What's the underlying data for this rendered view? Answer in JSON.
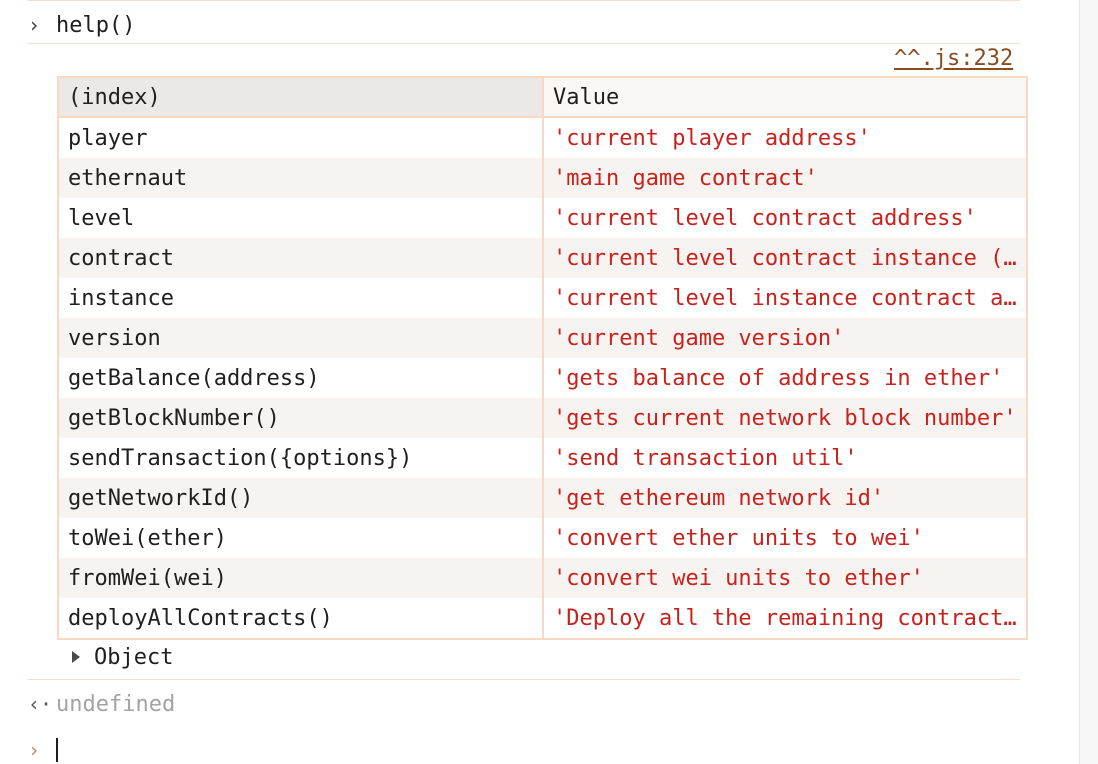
{
  "console": {
    "command": "help()",
    "input_prompt": "›",
    "source_link": "^^.js:232",
    "table": {
      "headers": [
        "(index)",
        "Value"
      ],
      "rows": [
        {
          "index": "player",
          "value": "'current player address'"
        },
        {
          "index": "ethernaut",
          "value": "'main game contract'"
        },
        {
          "index": "level",
          "value": "'current level contract address'"
        },
        {
          "index": "contract",
          "value": "'current level contract instance (…"
        },
        {
          "index": "instance",
          "value": "'current level instance contract a…"
        },
        {
          "index": "version",
          "value": "'current game version'"
        },
        {
          "index": "getBalance(address)",
          "value": "'gets balance of address in ether'"
        },
        {
          "index": "getBlockNumber()",
          "value": "'gets current network block number'"
        },
        {
          "index": "sendTransaction({options})",
          "value": "'send transaction util'"
        },
        {
          "index": "getNetworkId()",
          "value": "'get ethereum network id'"
        },
        {
          "index": "toWei(ether)",
          "value": "'convert ether units to wei'"
        },
        {
          "index": "fromWei(wei)",
          "value": "'convert wei units to ether'"
        },
        {
          "index": "deployAllContracts()",
          "value": "'Deploy all the remaining contract…"
        }
      ]
    },
    "object_label": "Object",
    "result_glyph": "‹·",
    "result_value": "undefined",
    "active_prompt": "›"
  },
  "colors": {
    "value_text": "#c9221d",
    "link": "#8a4b1e",
    "border": "#f8d9c4",
    "muted": "#a3a3a3"
  },
  "icons": {
    "input_prompt": "chevron-right-icon",
    "expand": "triangle-right-icon",
    "result": "return-arrow-icon"
  }
}
